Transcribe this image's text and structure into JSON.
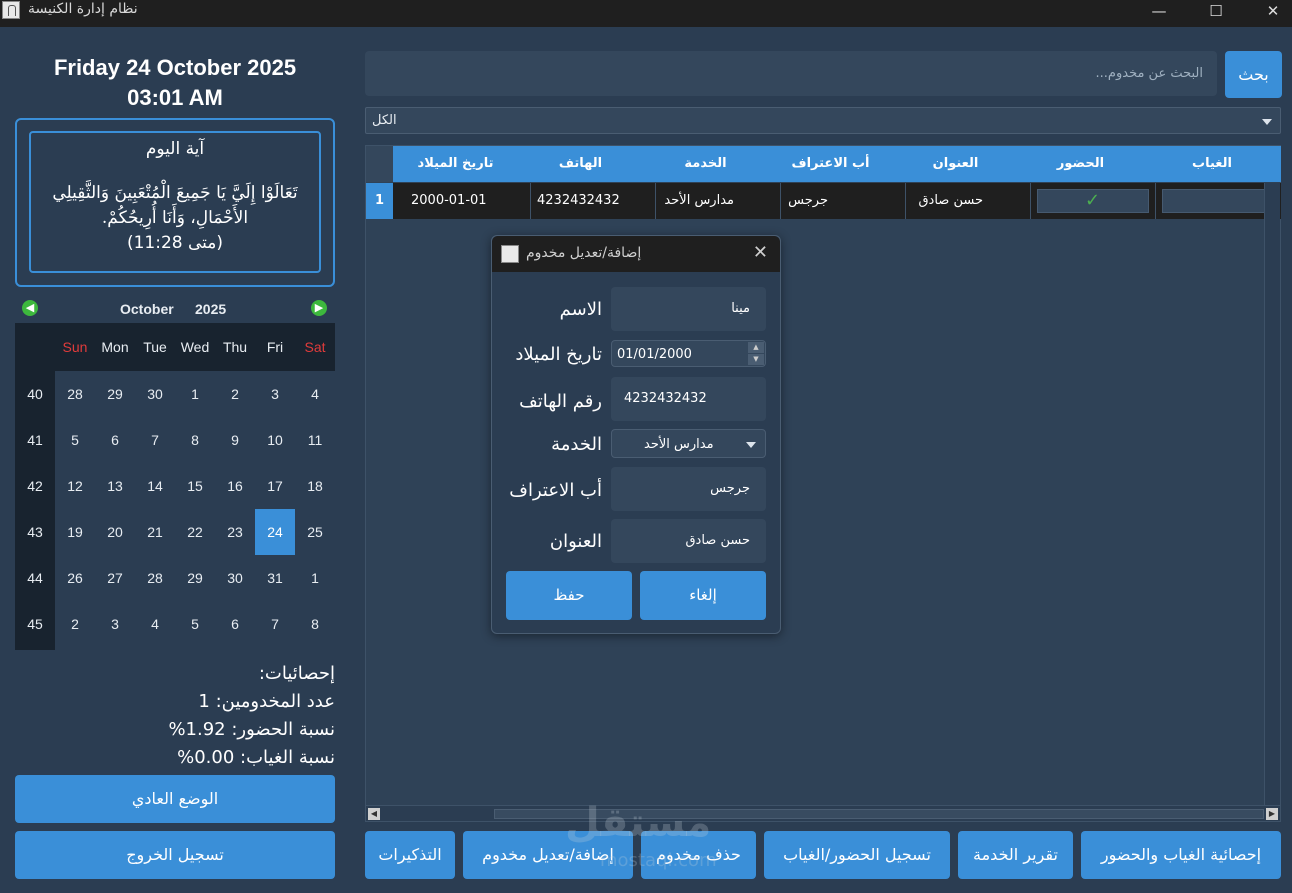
{
  "window": {
    "title": "نظام إدارة الكنيسة",
    "minimize": "—",
    "maximize": "☐",
    "close": "✕"
  },
  "left": {
    "date": "Friday 24 October 2025",
    "time": "03:01 AM",
    "verse": {
      "title": "آية اليوم",
      "body": "تَعَالَوْا إِلَيَّ يَا جَمِيعَ الْمُتْعَبِينَ وَالثَّقِيلِي الأَحْمَالِ، وَأَنَا أُرِيحُكُمْ.",
      "ref": "(متى 11:28)"
    },
    "calendar": {
      "month": "October",
      "year": "2025",
      "prev": "◀",
      "next": "▶",
      "days_header": [
        "Sun",
        "Mon",
        "Tue",
        "Wed",
        "Thu",
        "Fri",
        "Sat"
      ],
      "weeks": [
        "40",
        "41",
        "42",
        "43",
        "44",
        "45"
      ],
      "grid": [
        [
          "28",
          "29",
          "30",
          "1",
          "2",
          "3",
          "4"
        ],
        [
          "5",
          "6",
          "7",
          "8",
          "9",
          "10",
          "11"
        ],
        [
          "12",
          "13",
          "14",
          "15",
          "16",
          "17",
          "18"
        ],
        [
          "19",
          "20",
          "21",
          "22",
          "23",
          "24",
          "25"
        ],
        [
          "26",
          "27",
          "28",
          "29",
          "30",
          "31",
          "1"
        ],
        [
          "2",
          "3",
          "4",
          "5",
          "6",
          "7",
          "8"
        ]
      ],
      "today": "24"
    },
    "stats": {
      "heading": "إحصائيات:",
      "count": "عدد المخدومين: 1",
      "attendance": "نسبة الحضور: 1.92%",
      "absence": "نسبة الغياب: 0.00%"
    },
    "normal_mode": "الوضع العادي",
    "logout": "تسجيل الخروج"
  },
  "search": {
    "placeholder": "البحث عن مخدوم...",
    "button": "بحث"
  },
  "filter": {
    "value": "الكل"
  },
  "table": {
    "columns": [
      "تاريخ الميلاد",
      "الهاتف",
      "الخدمة",
      "أب الاعتراف",
      "العنوان",
      "الحضور",
      "الغياب"
    ],
    "rows": [
      {
        "index": "1",
        "birth": "2000-01-01",
        "phone": "4232432432",
        "service": "مدارس الأحد",
        "confessor": "جرجس",
        "address": "حسن صادق",
        "present": "✓",
        "absent": ""
      }
    ]
  },
  "dialog": {
    "title": "إضافة/تعديل مخدوم",
    "close": "✕",
    "name_label": "الاسم",
    "name_value": "مينا",
    "birth_label": "تاريخ الميلاد",
    "birth_value": "01/01/2000",
    "phone_label": "رقم الهاتف",
    "phone_value": "4232432432",
    "service_label": "الخدمة",
    "service_value": "مدارس الأحد",
    "confessor_label": "أب الاعتراف",
    "confessor_value": "جرجس",
    "address_label": "العنوان",
    "address_value": "حسن صادق",
    "save": "حفظ",
    "cancel": "إلغاء"
  },
  "toolbar": {
    "reminders": "التذكيرات",
    "add_edit": "إضافة/تعديل مخدوم",
    "delete": "حذف مخدوم",
    "attendance": "تسجيل الحضور/الغياب",
    "report": "تقرير الخدمة",
    "stats": "إحصائية الغياب والحضور"
  },
  "watermark": {
    "main": "مستقل",
    "sub": "mostaql.com"
  },
  "colors": {
    "accent": "#3a8fd8",
    "background": "#2b3d52",
    "panel": "#34475c",
    "weekend": "#e03b3b",
    "check": "#4caf50"
  }
}
